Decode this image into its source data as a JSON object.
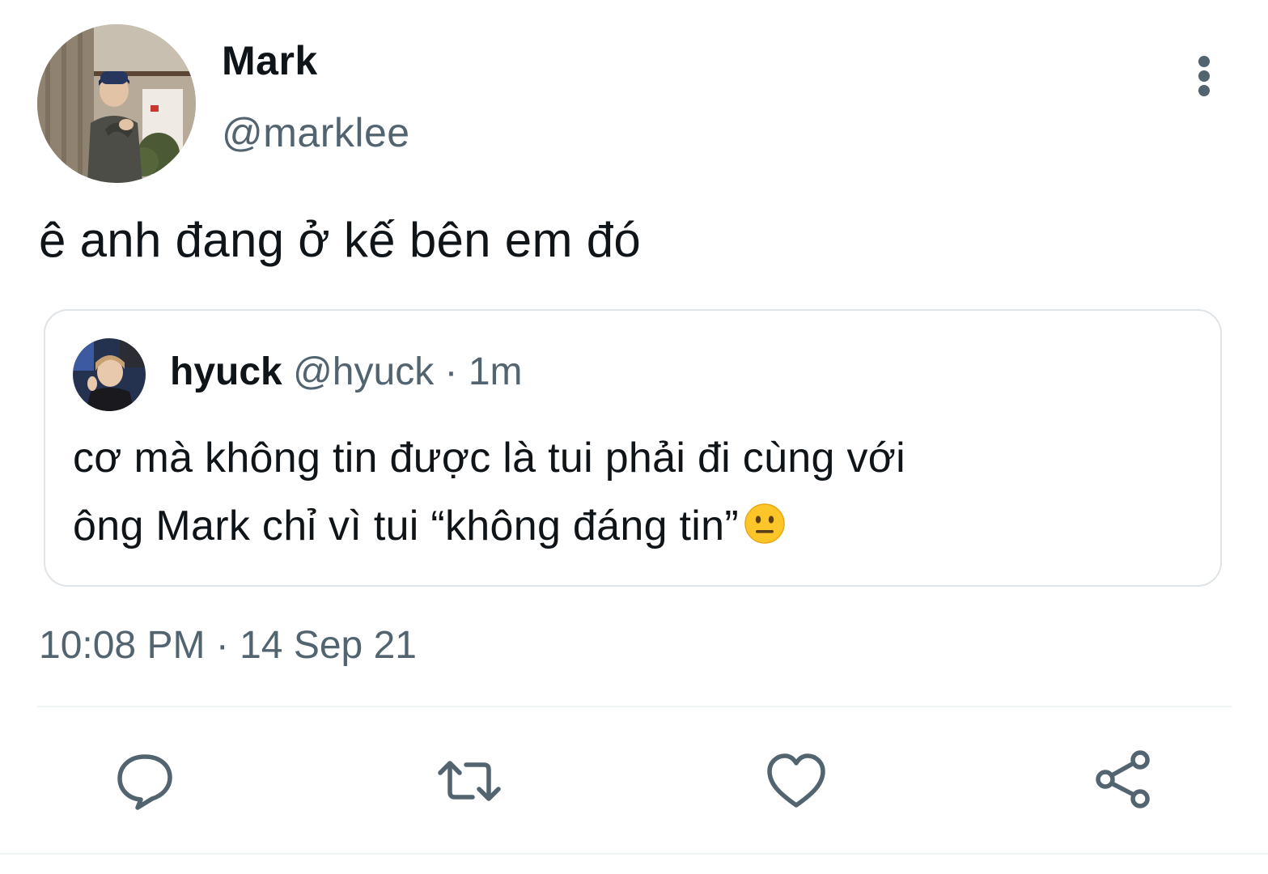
{
  "tweet": {
    "author": {
      "name": "Mark",
      "handle": "@marklee"
    },
    "text": "ê anh đang ở kế bên em đó",
    "timestamp": "10:08 PM · 14 Sep 21"
  },
  "quote": {
    "author_name": "hyuck",
    "author_handle": "@hyuck",
    "separator": " · ",
    "time": "1m",
    "text_line1": "cơ mà không tin được là tui phải đi cùng với",
    "text_line2": "ông Mark chỉ vì tui “không đáng tin”",
    "emoji": "neutral-face-emoji"
  },
  "actions": [
    {
      "icon": "reply-icon"
    },
    {
      "icon": "retweet-icon"
    },
    {
      "icon": "like-icon"
    },
    {
      "icon": "share-icon"
    }
  ],
  "colors": {
    "text_primary": "#0f1419",
    "text_secondary": "#536471",
    "border": "#dfe4e8",
    "icon": "#536471"
  }
}
